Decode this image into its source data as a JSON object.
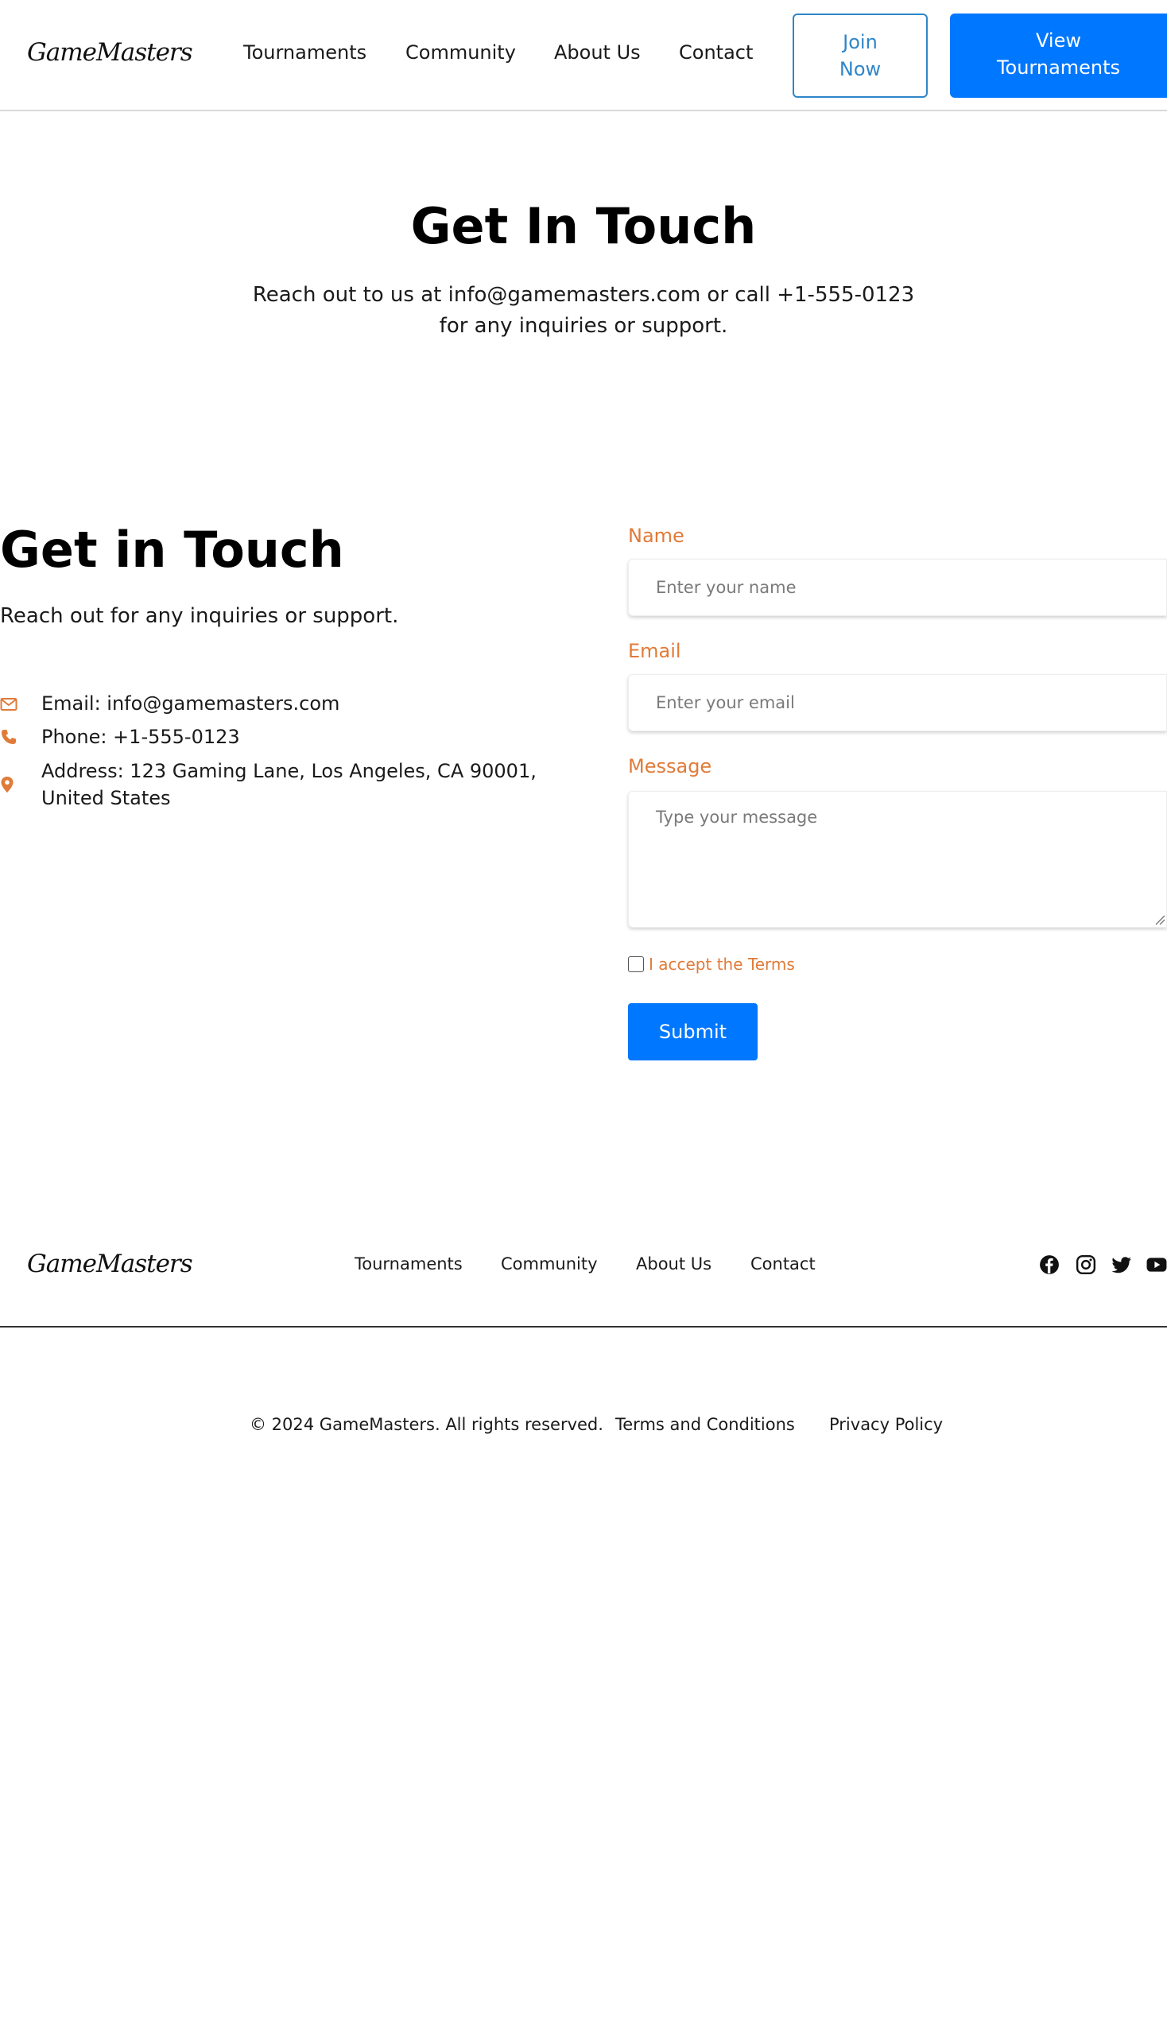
{
  "header": {
    "logo": "GameMasters",
    "nav": [
      "Tournaments",
      "Community",
      "About Us",
      "Contact"
    ],
    "join_line1": "Join",
    "join_line2": "Now",
    "view_line1": "View",
    "view_line2": "Tournaments"
  },
  "hero": {
    "title": "Get In Touch",
    "subtitle": "Reach out to us at info@gamemasters.com or call +1-555-0123 for any inquiries or support."
  },
  "contact": {
    "title": "Get in Touch",
    "subtitle": "Reach out for any inquiries or support.",
    "email": "Email: info@gamemasters.com",
    "phone": "Phone: +1-555-0123",
    "address": "Address: 123 Gaming Lane, Los Angeles, CA 90001, United States"
  },
  "form": {
    "name_label": "Name",
    "name_placeholder": "Enter your name",
    "email_label": "Email",
    "email_placeholder": "Enter your email",
    "message_label": "Message",
    "message_placeholder": "Type your message",
    "terms_label": "I accept the Terms",
    "submit_label": "Submit"
  },
  "footer": {
    "logo": "GameMasters",
    "nav": [
      "Tournaments",
      "Community",
      "About Us",
      "Contact"
    ],
    "social_icons": [
      "facebook-icon",
      "instagram-icon",
      "twitter-icon",
      "youtube-icon"
    ],
    "copyright": "© 2024 GameMasters. All rights reserved.",
    "terms_link": "Terms and Conditions",
    "privacy_link": "Privacy Policy"
  },
  "colors": {
    "primary": "#0077ff",
    "accent": "#e07b39",
    "outline_button": "#2f86c9"
  }
}
